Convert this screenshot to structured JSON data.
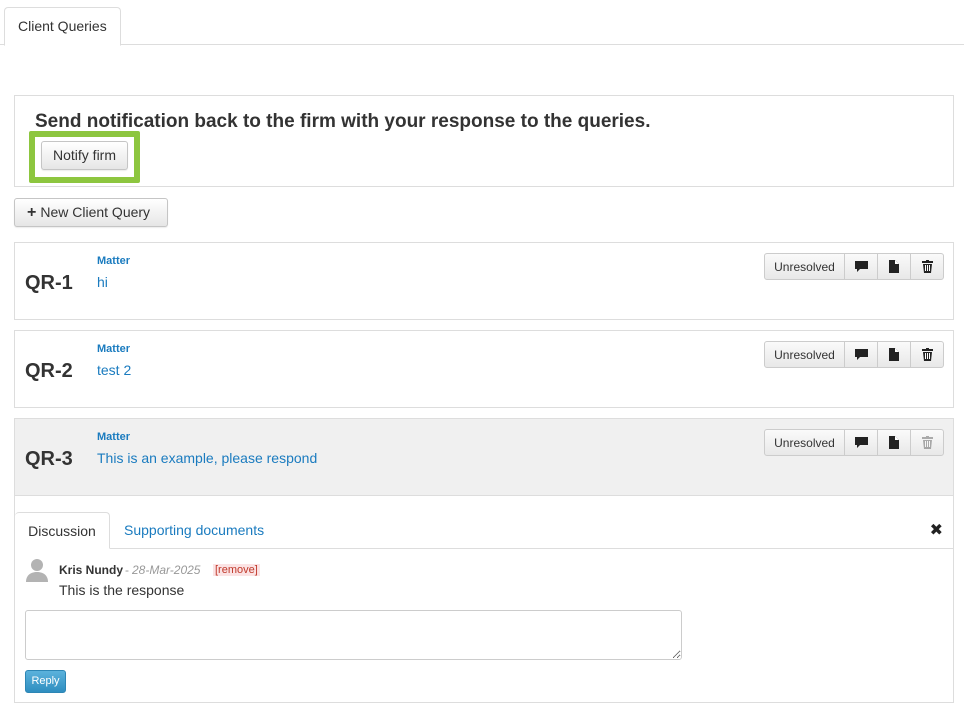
{
  "tabs": [
    {
      "label": "Client Queries"
    }
  ],
  "notify": {
    "title": "Send notification back to the firm with your response to the queries.",
    "button_label": "Notify firm",
    "highlight_color": "#8dc63f"
  },
  "new_query": {
    "label": "New Client Query",
    "icon": "plus-icon"
  },
  "queries": [
    {
      "id": "QR-1",
      "matter_label": "Matter",
      "text": "hi",
      "status": "Unresolved",
      "actions": [
        "comment-icon",
        "document-icon",
        "trash-icon"
      ]
    },
    {
      "id": "QR-2",
      "matter_label": "Matter",
      "text": "test 2",
      "status": "Unresolved",
      "actions": [
        "comment-icon",
        "document-icon",
        "trash-icon"
      ]
    },
    {
      "id": "QR-3",
      "matter_label": "Matter",
      "text": "This is an example, please respond",
      "status": "Unresolved",
      "actions": [
        "comment-icon",
        "document-icon",
        "trash-icon-disabled"
      ]
    }
  ],
  "expanded": {
    "tabs": [
      {
        "label": "Discussion"
      },
      {
        "label": "Supporting documents"
      }
    ],
    "close_icon": "close-icon",
    "comment": {
      "author": "Kris Nundy",
      "separator": "-",
      "date": "28-Mar-2025",
      "remove_label": "[remove]",
      "text": "This is the response",
      "avatar_icon": "user-avatar-icon"
    },
    "reply_placeholder": "",
    "reply_label": "Reply"
  },
  "colors": {
    "link": "#1a7bbf",
    "reply_button": "#3d9bcc",
    "selected_row": "#f0f0f0"
  }
}
